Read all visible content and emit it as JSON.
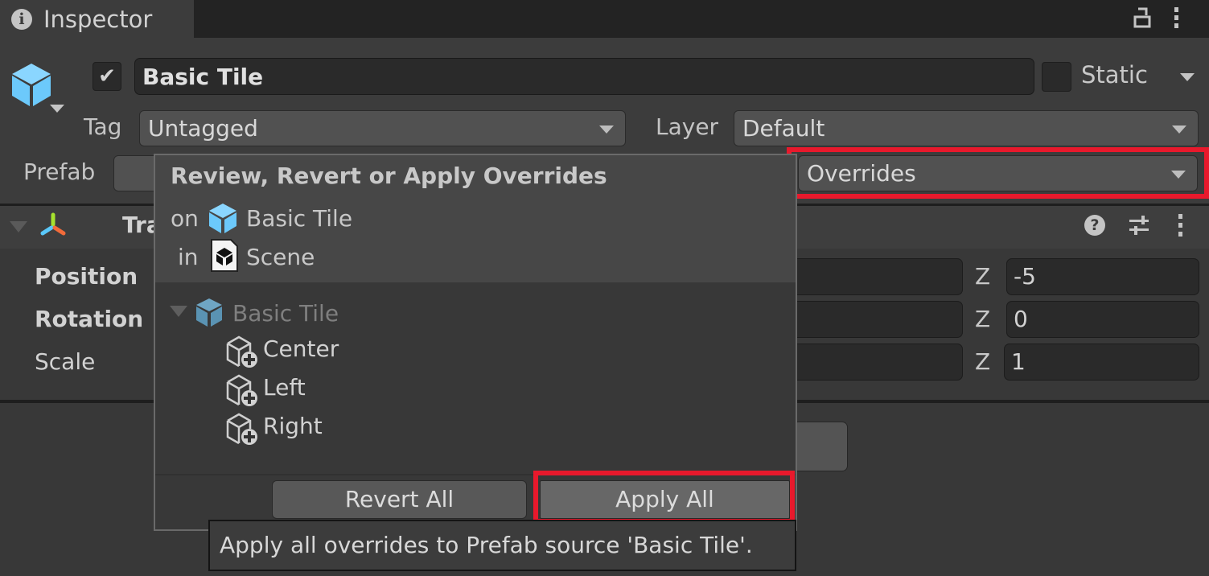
{
  "window": {
    "tab_title": "Inspector",
    "tab_icon": "info-icon",
    "toolbar_icons": [
      "lock-icon",
      "kebab-menu-icon"
    ]
  },
  "gameobject": {
    "icon": "cube-icon",
    "active": true,
    "name": "Basic Tile",
    "static_label": "Static",
    "static_checked": false,
    "tag_label": "Tag",
    "tag_value": "Untagged",
    "layer_label": "Layer",
    "layer_value": "Default",
    "prefab_label": "Prefab",
    "overrides_value": "Overrides"
  },
  "transform": {
    "title": "Transform",
    "title_visible": "Tra",
    "header_icons": [
      "help-icon",
      "presets-icon",
      "kebab-menu-icon"
    ],
    "rows": [
      {
        "label": "Position",
        "bold": true,
        "z_label": "Z",
        "z": "-5"
      },
      {
        "label": "Rotation",
        "bold": true,
        "z_label": "Z",
        "z": "0"
      },
      {
        "label": "Scale",
        "bold": false,
        "z_label": "Z",
        "z": "1"
      }
    ]
  },
  "overrides_popup": {
    "title": "Review, Revert or Apply Overrides",
    "on_label": "on",
    "on_target": "Basic Tile",
    "in_label": "in",
    "in_target": "Scene",
    "tree_root": "Basic Tile",
    "children": [
      {
        "label": "Center",
        "icon": "added-gameobject-icon"
      },
      {
        "label": "Left",
        "icon": "added-gameobject-icon"
      },
      {
        "label": "Right",
        "icon": "added-gameobject-icon"
      }
    ],
    "revert_all_label": "Revert All",
    "apply_all_label": "Apply All"
  },
  "tooltip": {
    "text": "Apply all overrides to Prefab source 'Basic Tile'."
  },
  "colors": {
    "highlight": "#e8192c",
    "cube_blue": "#6cc9fb",
    "panel_bg": "#3c3c3c"
  }
}
